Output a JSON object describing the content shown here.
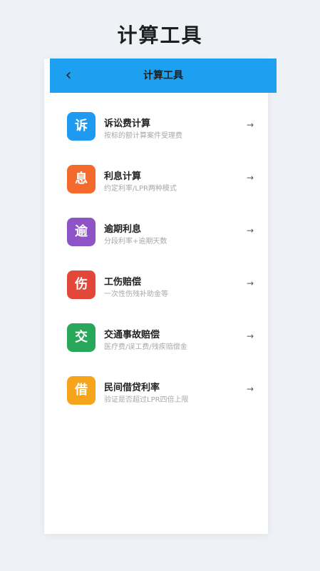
{
  "page": {
    "heading": "计算工具"
  },
  "appbar": {
    "back_icon": "back-chevron-icon",
    "back_glyph": "‹",
    "title": "计算工具",
    "color": "#1ea0f0"
  },
  "items": [
    {
      "glyph": "诉",
      "title": "诉讼费计算",
      "subtitle": "按标的额计算案件受理费",
      "color": "#1e9bf0",
      "arrow": "→"
    },
    {
      "glyph": "息",
      "title": "利息计算",
      "subtitle": "约定利率/LPR两种模式",
      "color": "#f36a2c",
      "arrow": "→"
    },
    {
      "glyph": "逾",
      "title": "逾期利息",
      "subtitle": "分段利率+逾期天数",
      "color": "#8e53c6",
      "arrow": "→"
    },
    {
      "glyph": "伤",
      "title": "工伤赔偿",
      "subtitle": "一次性伤残补助金等",
      "color": "#e2473a",
      "arrow": "→"
    },
    {
      "glyph": "交",
      "title": "交通事故赔偿",
      "subtitle": "医疗费/误工费/残疾赔偿金",
      "color": "#28a75a",
      "arrow": "→"
    },
    {
      "glyph": "借",
      "title": "民间借贷利率",
      "subtitle": "验证是否超过LPR四倍上限",
      "color": "#f5a41c",
      "arrow": "→"
    }
  ]
}
